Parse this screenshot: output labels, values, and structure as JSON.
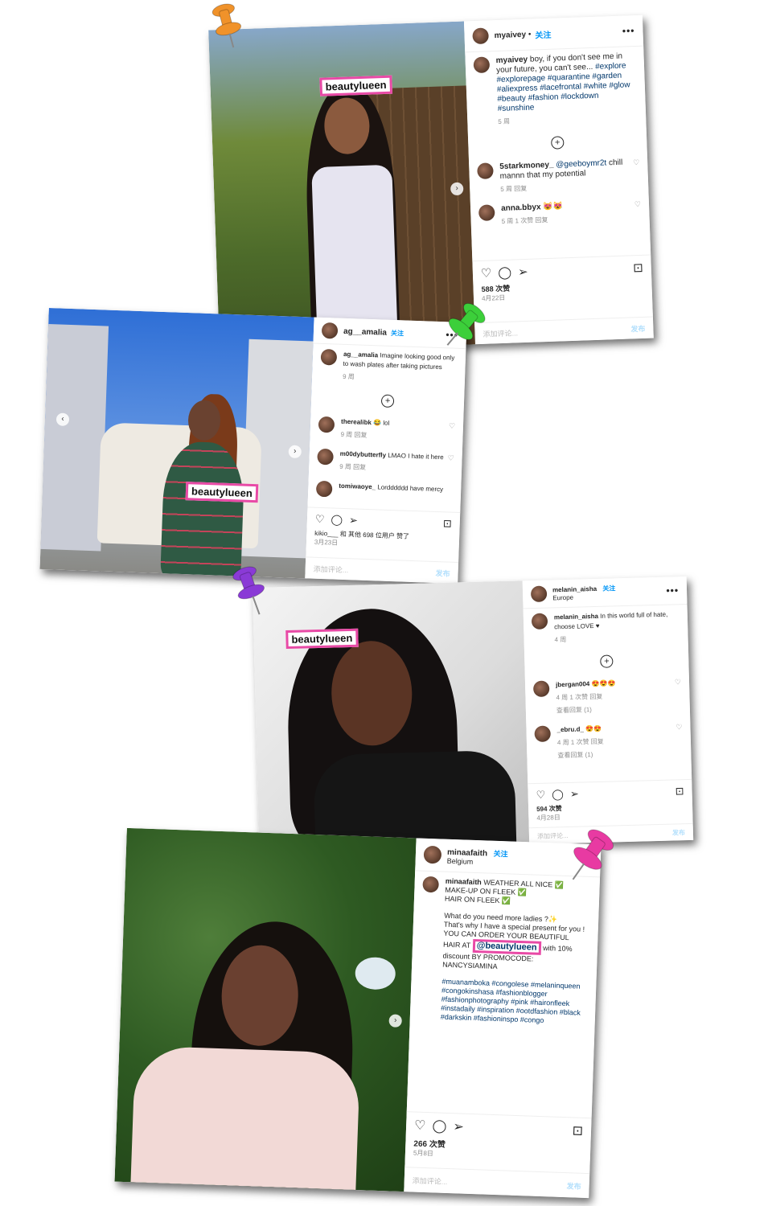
{
  "posts": [
    {
      "username": "myaivey",
      "follow": "关注",
      "brand_label": "beautylueen",
      "caption_user": "myaivey",
      "caption_text": "boy, if you don't see me in your future, you can't see...",
      "caption_tags": "#explore #explorepage #quarantine #garden #aliexpress #lacefrontal #white #glow #beauty #fashion #lockdown #sunshine",
      "caption_meta": "5 周",
      "comments": [
        {
          "user": "5starkmoney_",
          "mention": "@geeboymr2t",
          "text": "chill mannn that my potential",
          "meta": "5 周   回复"
        },
        {
          "user": "anna.bbyx",
          "text": "😻😻",
          "meta": "5 周   1 次赞   回复"
        }
      ],
      "likes": "588 次赞",
      "date": "4月22日",
      "add_comment": "添加评论...",
      "post_btn": "发布",
      "colors": {
        "bg_top": "#6f8a3a",
        "fence": "#5a4028",
        "dress": "#e6e4f0"
      }
    },
    {
      "username": "ag__amalia",
      "follow": "关注",
      "brand_label": "beautylueen",
      "caption_user": "ag__amalia",
      "caption_text": "Imagine looking good only to wash plates after taking pictures",
      "caption_meta": "9 周",
      "comments": [
        {
          "user": "therealibk",
          "text": "😂 lol",
          "meta": "9 周   回复"
        },
        {
          "user": "m00dybutterfly",
          "text": "LMAO I hate it here",
          "meta": "9 周   回复"
        },
        {
          "user": "tomiwaoye_",
          "text": "Lordddddd have mercy",
          "meta": ""
        }
      ],
      "likes": "kikio___ 和 其他 698 位用户 赞了",
      "date": "3月23日",
      "add_comment": "添加评论...",
      "post_btn": "发布",
      "colors": {
        "sky": "#2f6fd6",
        "dress": "#2f5a44"
      }
    },
    {
      "username": "melanin_aisha",
      "follow": "关注",
      "location": "Europe",
      "brand_label": "beautylueen",
      "caption_user": "melanin_aisha",
      "caption_text": "In this world full of hate, choose LOVE ♥",
      "caption_meta": "4 周",
      "comments": [
        {
          "user": "jbergan004",
          "text": "😍😍😍",
          "meta": "4 周   1 次赞   回复",
          "replies": "查看回复 (1)"
        },
        {
          "user": "_ebru.d_",
          "text": "😍😍",
          "meta": "4 周   1 次赞   回复",
          "replies": "查看回复 (1)"
        }
      ],
      "likes": "594 次赞",
      "date": "4月28日",
      "add_comment": "添加评论...",
      "post_btn": "发布",
      "colors": {
        "bg": "#e9e9e9",
        "top": "#151515"
      }
    },
    {
      "username": "minaafaith",
      "follow": "关注",
      "location": "Belgium",
      "caption_user": "minaafaith",
      "caption_lines": [
        "WEATHER ALL NICE ✅",
        "MAKE-UP ON FLEEK ✅",
        "HAIR ON FLEEK ✅",
        "",
        "What do you need more ladies ?✨",
        "That's why I have a special present for you !",
        "YOU CAN ORDER YOUR BEAUTIFUL",
        "HAIR AT",
        "with 10% discount BY PROMOCODE:",
        "NANCYSIAMINA"
      ],
      "mention_label": "@beautylueen",
      "caption_tags": "#muanamboka #congolese #melaninqueen #congokinshasa #fashionblogger #fashionphotography #pink #haironfleek #instadaily #inspiration #ootdfashion #black #darkskin #fashioninspo #congo",
      "likes": "266 次赞",
      "date": "5月8日",
      "add_comment": "添加评论...",
      "post_btn": "发布",
      "colors": {
        "foliage": "#2e5a22",
        "blouse": "#f2d9d6"
      }
    }
  ],
  "pins": [
    {
      "name": "orange-pushpin-icon",
      "color": "#f0922a"
    },
    {
      "name": "green-pushpin-icon",
      "color": "#3ccf3a"
    },
    {
      "name": "purple-pushpin-icon",
      "color": "#8a3ad6"
    },
    {
      "name": "pink-pushpin-icon",
      "color": "#e83aa2"
    }
  ],
  "icons": {
    "like": "♡",
    "comment": "◯",
    "share": "➢",
    "save": "⊡",
    "more": "•••",
    "plus": "+",
    "next": "›",
    "prev": "‹"
  }
}
